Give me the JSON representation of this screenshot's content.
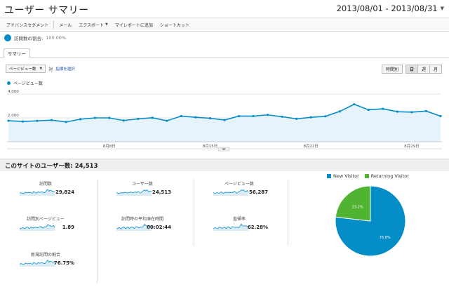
{
  "header": {
    "title": "ユーザー サマリー",
    "date_range": "2013/08/01 - 2013/08/31"
  },
  "toolbar": {
    "advanced_segments": "アドバンスセグメント",
    "email": "メール",
    "export": "エクスポート",
    "add_to_dashboard": "マイレポートに追加",
    "shortcut": "ショートカット"
  },
  "segment": {
    "label": "訪問数の割合:",
    "percent": "100.00%"
  },
  "tab": {
    "label": "サマリー"
  },
  "controls": {
    "metric_dropdown": "ページビュー数",
    "vs": "対",
    "select_metric": "指標を選択",
    "periods": [
      "時間別",
      "日",
      "週",
      "月"
    ],
    "active_period": "日"
  },
  "chart_legend": "ページビュー数",
  "chart_data": {
    "type": "area",
    "series": [
      {
        "name": "ページビュー数",
        "values": [
          1760,
          1700,
          1750,
          1810,
          1660,
          1890,
          2000,
          2000,
          1780,
          1920,
          2010,
          1760,
          2150,
          2050,
          1970,
          1820,
          2150,
          2150,
          2250,
          2100,
          1920,
          2050,
          2130,
          2540,
          3140,
          2680,
          2760,
          2520,
          2480,
          2570,
          2150
        ]
      }
    ],
    "x": [
      "8月1日",
      "8月2日",
      "8月3日",
      "8月4日",
      "8月5日",
      "8月6日",
      "8月7日",
      "8月8日",
      "8月9日",
      "8月10日",
      "8月11日",
      "8月12日",
      "8月13日",
      "8月14日",
      "8月15日",
      "8月16日",
      "8月17日",
      "8月18日",
      "8月19日",
      "8月20日",
      "8月21日",
      "8月22日",
      "8月23日",
      "8月24日",
      "8月25日",
      "8月26日",
      "8月27日",
      "8月28日",
      "8月29日",
      "8月30日",
      "8月31日"
    ],
    "x_tick_labels": [
      "8月8日",
      "8月15日",
      "8月22日",
      "8月29日"
    ],
    "y_tick_labels": [
      "4,000",
      "2,000"
    ],
    "ylim": [
      0,
      4000
    ],
    "grid": true,
    "colors": {
      "line": "#058dc7",
      "fill": "#e6f3fa"
    }
  },
  "summary_title": "このサイトのユーザー数: 24,513",
  "metrics": [
    {
      "label": "訪問数",
      "value": "29,824"
    },
    {
      "label": "ユーザー数",
      "value": "24,513"
    },
    {
      "label": "ページビュー数",
      "value": "56,287"
    },
    {
      "label": "訪問別ページビュー",
      "value": "1.89"
    },
    {
      "label": "訪問時の平均滞在時間",
      "value": "00:02:44"
    },
    {
      "label": "直帰率",
      "value": "62.28%"
    },
    {
      "label": "新規訪問の割合",
      "value": "76.75%"
    }
  ],
  "pie": {
    "legend": [
      {
        "label": "New Visitor",
        "color": "#058dc7"
      },
      {
        "label": "Returning Visitor",
        "color": "#50b432"
      }
    ],
    "slices": [
      {
        "label": "76.8%",
        "value": 76.8,
        "color": "#058dc7"
      },
      {
        "label": "23.2%",
        "value": 23.2,
        "color": "#50b432"
      }
    ]
  }
}
